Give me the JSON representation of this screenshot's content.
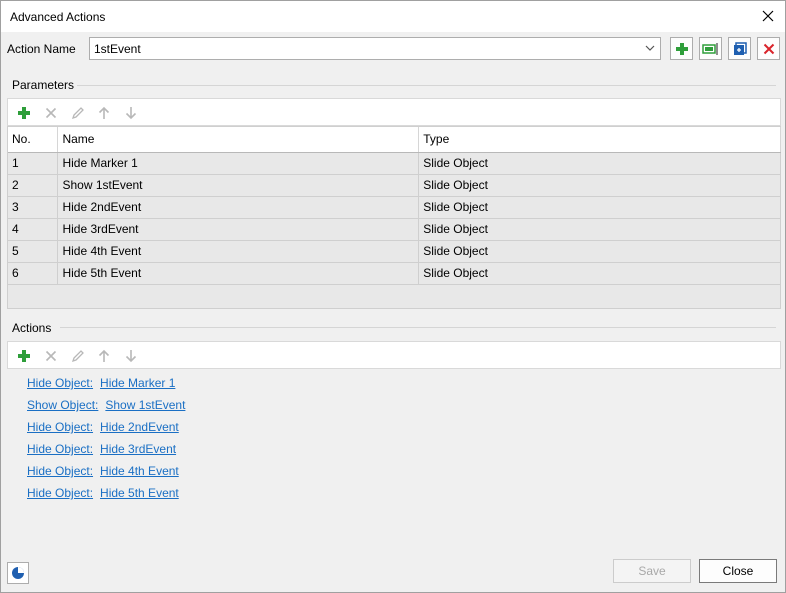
{
  "window": {
    "title": "Advanced Actions"
  },
  "action_name": {
    "label": "Action Name",
    "value": "1stEvent"
  },
  "header_buttons": [
    {
      "icon": "add-icon",
      "color": "#2e9e3a"
    },
    {
      "icon": "duplicate-action-icon",
      "color": "#2e9e3a"
    },
    {
      "icon": "copy-icon",
      "color": "#1f5fb0"
    },
    {
      "icon": "delete-icon",
      "color": "#d9232a"
    }
  ],
  "parameters": {
    "label": "Parameters",
    "columns": [
      "No.",
      "Name",
      "Type"
    ],
    "rows": [
      [
        "1",
        "Hide Marker 1",
        "Slide Object"
      ],
      [
        "2",
        "Show 1stEvent",
        "Slide Object"
      ],
      [
        "3",
        "Hide 2ndEvent",
        "Slide Object"
      ],
      [
        "4",
        "Hide 3rdEvent",
        "Slide Object"
      ],
      [
        "5",
        "Hide 4th Event",
        "Slide Object"
      ],
      [
        "6",
        "Hide 5th Event",
        "Slide Object"
      ]
    ]
  },
  "actions": {
    "label": "Actions",
    "items": [
      {
        "action": "Hide Object:",
        "target": "Hide Marker 1"
      },
      {
        "action": "Show Object:",
        "target": "Show 1stEvent"
      },
      {
        "action": "Hide Object:",
        "target": "Hide 2ndEvent"
      },
      {
        "action": "Hide Object:",
        "target": "Hide 3rdEvent"
      },
      {
        "action": "Hide Object:",
        "target": "Hide 4th Event"
      },
      {
        "action": "Hide Object:",
        "target": "Hide 5th Event"
      }
    ]
  },
  "toolbar_icons": [
    "add-icon",
    "delete-icon",
    "edit-icon",
    "move-up-icon",
    "move-down-icon"
  ],
  "footer": {
    "save_label": "Save",
    "close_label": "Close"
  },
  "colors": {
    "link": "#1a6fc4",
    "add": "#2e9e3a",
    "delete": "#d9232a"
  }
}
